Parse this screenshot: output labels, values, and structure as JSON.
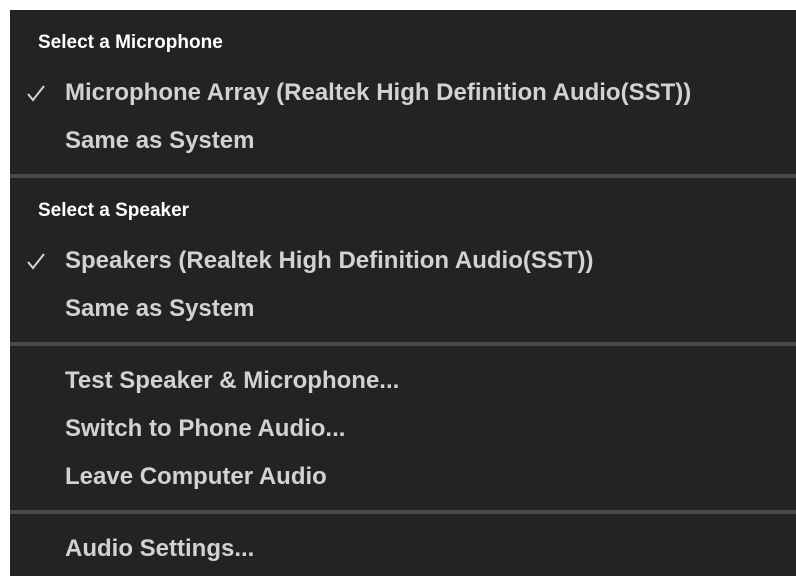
{
  "microphone_section": {
    "header": "Select a Microphone",
    "items": [
      {
        "label": "Microphone Array (Realtek High Definition Audio(SST))",
        "checked": true
      },
      {
        "label": "Same as System",
        "checked": false
      }
    ]
  },
  "speaker_section": {
    "header": "Select a Speaker",
    "items": [
      {
        "label": "Speakers (Realtek High Definition Audio(SST))",
        "checked": true
      },
      {
        "label": "Same as System",
        "checked": false
      }
    ]
  },
  "actions": {
    "test": "Test Speaker & Microphone...",
    "switch_phone": "Switch to Phone Audio...",
    "leave": "Leave Computer Audio"
  },
  "settings": {
    "audio_settings": "Audio Settings..."
  },
  "colors": {
    "background": "#232326",
    "separator": "#4a4a4d",
    "text": "#d2d2d2",
    "header_text": "#ffffff"
  }
}
